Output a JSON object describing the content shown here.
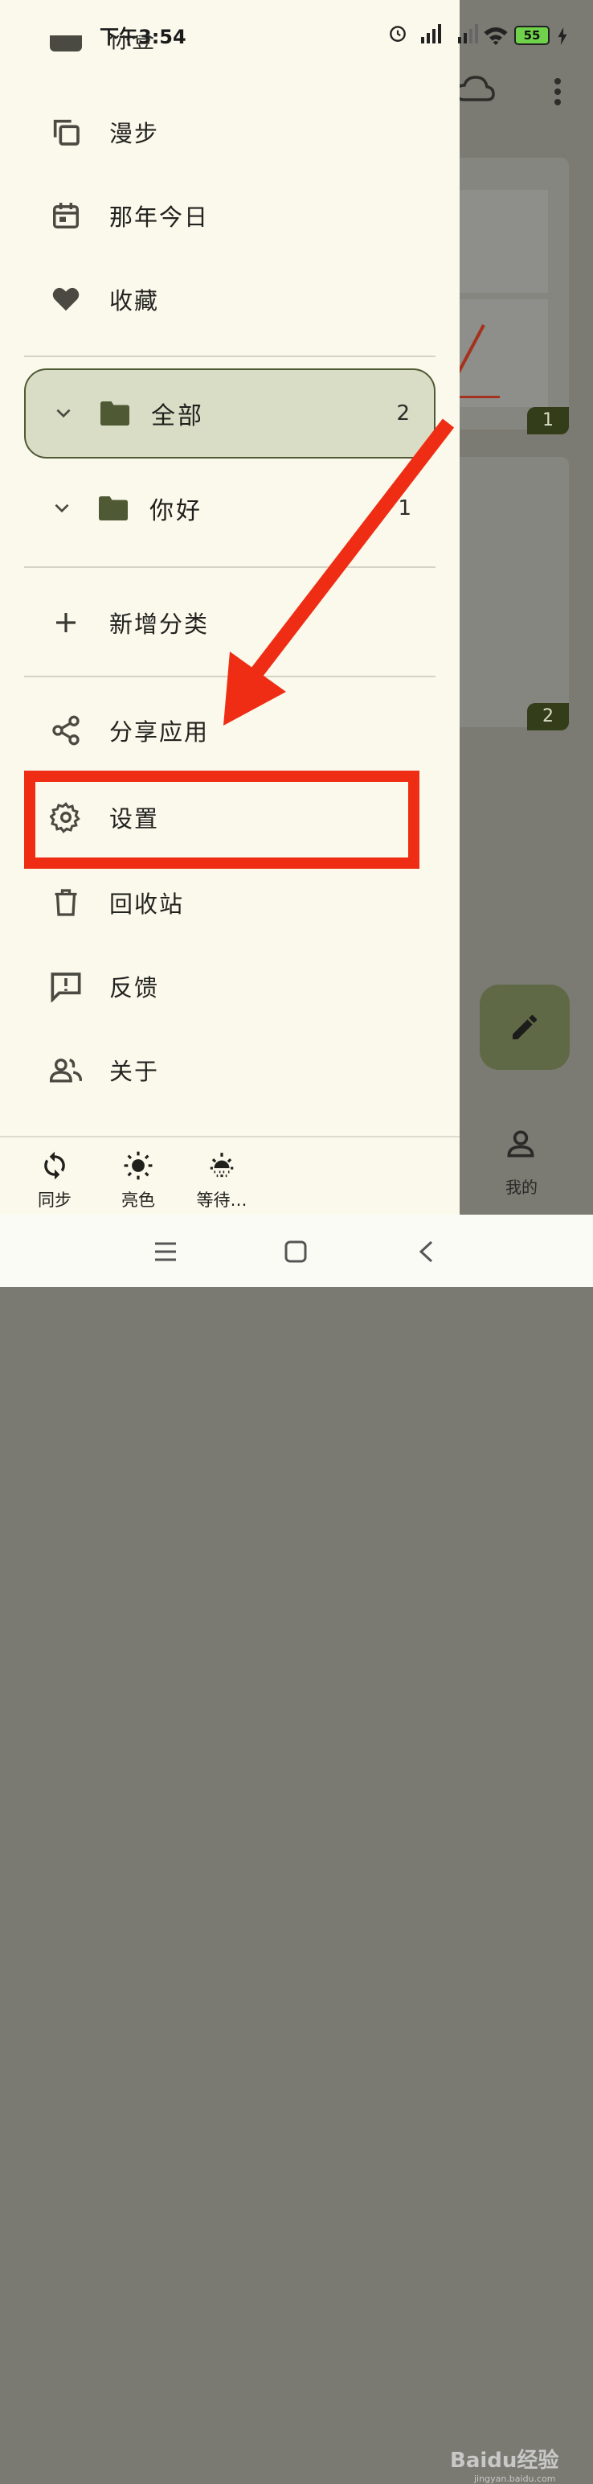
{
  "status_bar": {
    "time": "下午3:54",
    "battery": "55",
    "icons": [
      "alarm-icon",
      "signal-hd-icon",
      "signal-hd-icon",
      "wifi-icon",
      "battery-icon",
      "charging-icon"
    ]
  },
  "drawer": {
    "partial_item_label": "你登",
    "top_items": [
      {
        "label": "漫步",
        "icon": "copy-icon"
      },
      {
        "label": "那年今日",
        "icon": "calendar-icon"
      },
      {
        "label": "收藏",
        "icon": "heart-icon"
      }
    ],
    "categories": [
      {
        "name": "全部",
        "count": "2",
        "selected": true
      },
      {
        "name": "你好",
        "count": "1",
        "selected": false
      }
    ],
    "add_category": "新增分类",
    "bottom_items": [
      {
        "label": "分享应用",
        "icon": "share-icon"
      },
      {
        "label": "设置",
        "icon": "gear-icon"
      },
      {
        "label": "回收站",
        "icon": "trash-icon"
      },
      {
        "label": "反馈",
        "icon": "feedback-icon"
      },
      {
        "label": "关于",
        "icon": "people-icon"
      }
    ],
    "bottom_bar": [
      {
        "label": "同步",
        "icon": "sync-icon"
      },
      {
        "label": "亮色",
        "icon": "sun-icon"
      },
      {
        "label": "等待…",
        "icon": "sunset-icon"
      }
    ]
  },
  "background_app": {
    "card1_badge": "1",
    "card2_badge": "2",
    "mine_label": "我的"
  },
  "watermark": {
    "text": "Baidu经验",
    "sub": "jingyan.baidu.com"
  },
  "colors": {
    "drawer_bg": "#fbf9ec",
    "selected_bg": "#d9ddc6",
    "accent": "#4f5a34",
    "annotation": "#ef2d14"
  }
}
